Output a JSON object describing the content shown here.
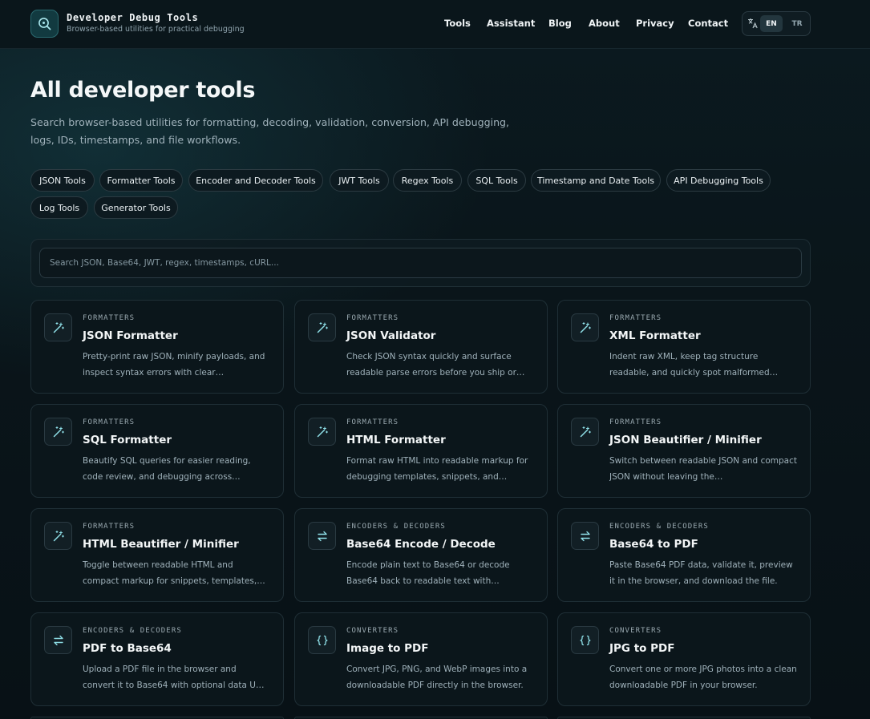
{
  "brand": {
    "title": "Developer Debug Tools",
    "subtitle": "Browser-based utilities for practical debugging",
    "logo_icon": "search-code-icon"
  },
  "nav": {
    "items": [
      "Tools",
      "Assistant",
      "Blog",
      "About",
      "Privacy",
      "Contact"
    ],
    "language": {
      "icon": "translate-icon",
      "options": [
        "EN",
        "TR"
      ],
      "selected": "EN"
    }
  },
  "hero": {
    "title": "All developer tools",
    "description": "Search browser-based utilities for formatting, decoding, validation, conversion, API debugging, logs, IDs, timestamps, and file workflows."
  },
  "categories": [
    "JSON Tools",
    "Formatter Tools",
    "Encoder and Decoder Tools",
    "JWT Tools",
    "Regex Tools",
    "SQL Tools",
    "Timestamp and Date Tools",
    "API Debugging Tools",
    "Log Tools",
    "Generator Tools"
  ],
  "search": {
    "placeholder": "Search JSON, Base64, JWT, regex, timestamps, cURL...",
    "value": ""
  },
  "cards": [
    {
      "category": "FORMATTERS",
      "icon": "magic-wand-icon",
      "title": "JSON Formatter",
      "description": "Pretty-print raw JSON, minify payloads, and inspect syntax errors with clear…"
    },
    {
      "category": "FORMATTERS",
      "icon": "magic-wand-icon",
      "title": "JSON Validator",
      "description": "Check JSON syntax quickly and surface readable parse errors before you ship or…"
    },
    {
      "category": "FORMATTERS",
      "icon": "magic-wand-icon",
      "title": "XML Formatter",
      "description": "Indent raw XML, keep tag structure readable, and quickly spot malformed…"
    },
    {
      "category": "FORMATTERS",
      "icon": "magic-wand-icon",
      "title": "SQL Formatter",
      "description": "Beautify SQL queries for easier reading, code review, and debugging across…"
    },
    {
      "category": "FORMATTERS",
      "icon": "magic-wand-icon",
      "title": "HTML Formatter",
      "description": "Format raw HTML into readable markup for debugging templates, snippets, and…"
    },
    {
      "category": "FORMATTERS",
      "icon": "magic-wand-icon",
      "title": "JSON Beautifier / Minifier",
      "description": "Switch between readable JSON and compact JSON without leaving the…"
    },
    {
      "category": "FORMATTERS",
      "icon": "magic-wand-icon",
      "title": "HTML Beautifier / Minifier",
      "description": "Toggle between readable HTML and compact markup for snippets, templates,…"
    },
    {
      "category": "ENCODERS & DECODERS",
      "icon": "swap-arrows-icon",
      "title": "Base64 Encode / Decode",
      "description": "Encode plain text to Base64 or decode Base64 back to readable text with…"
    },
    {
      "category": "ENCODERS & DECODERS",
      "icon": "swap-arrows-icon",
      "title": "Base64 to PDF",
      "description": "Paste Base64 PDF data, validate it, preview it in the browser, and download the file."
    },
    {
      "category": "ENCODERS & DECODERS",
      "icon": "swap-arrows-icon",
      "title": "PDF to Base64",
      "description": "Upload a PDF file in the browser and convert it to Base64 with optional data U…"
    },
    {
      "category": "CONVERTERS",
      "icon": "braces-icon",
      "title": "Image to PDF",
      "description": "Convert JPG, PNG, and WebP images into a downloadable PDF directly in the browser."
    },
    {
      "category": "CONVERTERS",
      "icon": "braces-icon",
      "title": "JPG to PDF",
      "description": "Convert one or more JPG photos into a clean downloadable PDF in your browser."
    }
  ],
  "colors": {
    "background": "#0a151a",
    "accent": "#7fd6df",
    "card_bg": "#0b161b",
    "border": "#1f2f36"
  }
}
